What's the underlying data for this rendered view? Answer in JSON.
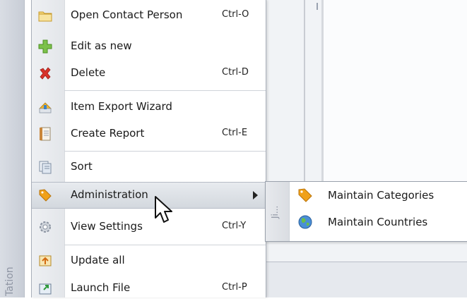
{
  "background": {
    "left_strip_label": "Tation"
  },
  "menu": {
    "items": [
      {
        "label": "Open Contact Person",
        "shortcut": "Ctrl-O",
        "icon": "folder-icon"
      },
      {
        "label": "Edit as new",
        "shortcut": "",
        "icon": "plus-icon"
      },
      {
        "label": "Delete",
        "shortcut": "Ctrl-D",
        "icon": "red-x-icon"
      },
      {
        "label": "Item Export Wizard",
        "shortcut": "",
        "icon": "export-wizard-icon"
      },
      {
        "label": "Create Report",
        "shortcut": "Ctrl-E",
        "icon": "report-icon"
      },
      {
        "label": "Sort",
        "shortcut": "",
        "icon": "sort-icon"
      },
      {
        "label": "Administration",
        "shortcut": "",
        "icon": "tag-icon",
        "has_submenu": true
      },
      {
        "label": "View Settings",
        "shortcut": "Ctrl-Y",
        "icon": "settings-gear-icon"
      },
      {
        "label": "Update all",
        "shortcut": "",
        "icon": "update-icon"
      },
      {
        "label": "Launch File",
        "shortcut": "Ctrl-P",
        "icon": "launch-file-icon"
      }
    ]
  },
  "submenu": {
    "vertical_label": "Ji...",
    "items": [
      {
        "label": "Maintain Categories",
        "icon": "tag-icon"
      },
      {
        "label": "Maintain Countries",
        "icon": "globe-icon"
      }
    ]
  },
  "colors": {
    "highlight_top": "#e8ebef",
    "highlight_bottom": "#d3d8de",
    "delete_red": "#d8322a",
    "plus_green": "#6cbb3c",
    "tag_orange": "#f0a11a"
  }
}
